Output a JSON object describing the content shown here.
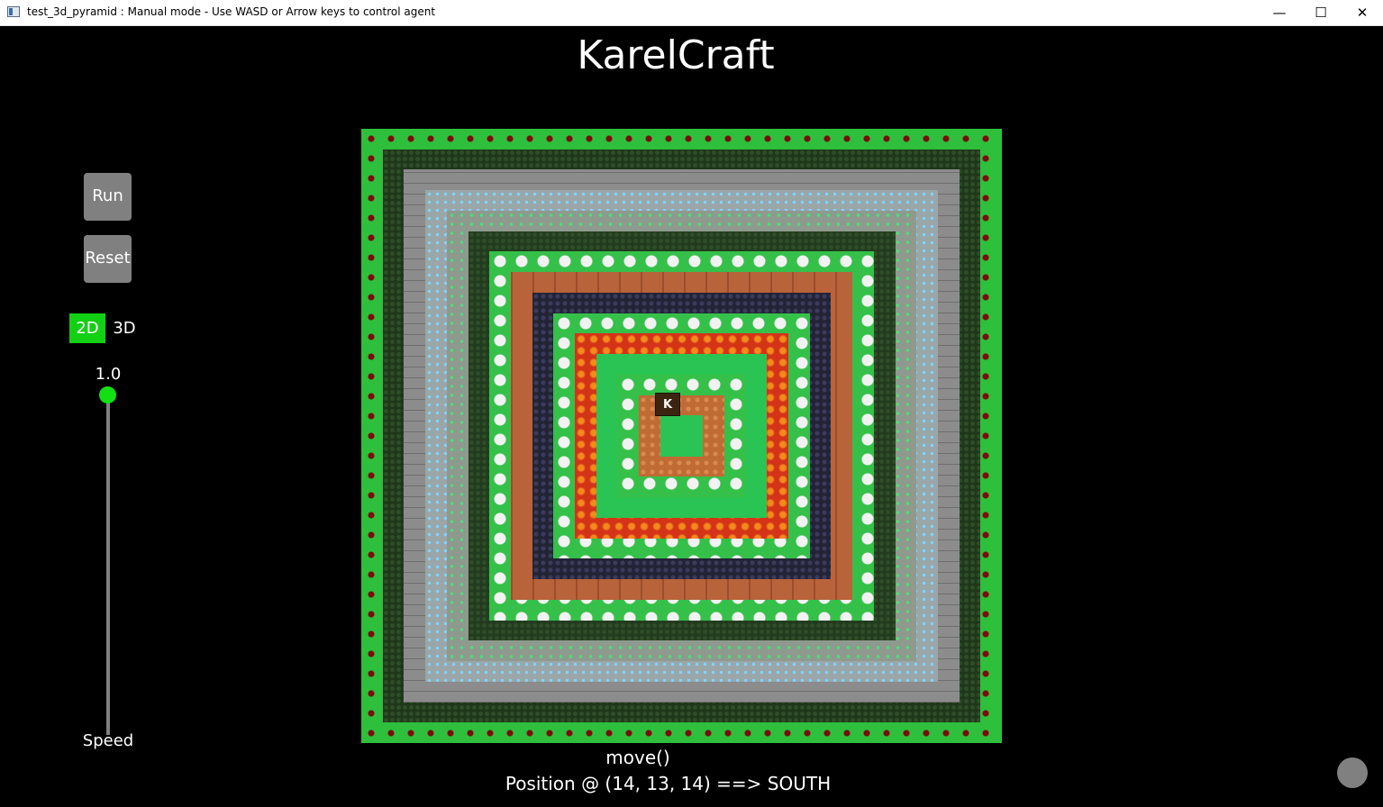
{
  "window": {
    "title": "test_3d_pyramid : Manual mode - Use WASD or Arrow keys to control agent"
  },
  "app": {
    "title": "KarelCraft"
  },
  "controls": {
    "run_label": "Run",
    "reset_label": "Reset",
    "view_2d_label": "2D",
    "view_3d_label": "3D",
    "active_view": "2D",
    "speed_value": "1.0",
    "speed_fraction": 1.0,
    "speed_label": "Speed"
  },
  "agent": {
    "label": "K"
  },
  "status": {
    "command": "move()",
    "position": "Position @ (14, 13, 14) ==> SOUTH"
  },
  "colors": {
    "accent": "#12d012",
    "button_gray": "#808080"
  },
  "world_rings": [
    {
      "block": "grass-with-red-flowers",
      "color": "#2ebf3c"
    },
    {
      "block": "dark-moss",
      "color": "#1e3619"
    },
    {
      "block": "stone-brick",
      "color": "#8c8c8c"
    },
    {
      "block": "diamond-ore",
      "color": "#9aa6a8"
    },
    {
      "block": "emerald-ore",
      "color": "#8e9a8e"
    },
    {
      "block": "dark-moss",
      "color": "#223a1e"
    },
    {
      "block": "grass-with-white-flowers",
      "color": "#35c04a"
    },
    {
      "block": "terracotta",
      "color": "#b8633a"
    },
    {
      "block": "obsidian",
      "color": "#232336"
    },
    {
      "block": "grass-with-white-flowers",
      "color": "#35c04a"
    },
    {
      "block": "lava",
      "color": "#d43317"
    },
    {
      "block": "grass",
      "color": "#2ac454"
    },
    {
      "block": "grass-with-white-flowers",
      "color": "#35c04a"
    },
    {
      "block": "copper",
      "color": "#c06a34"
    },
    {
      "block": "grass",
      "color": "#2ac454"
    }
  ]
}
